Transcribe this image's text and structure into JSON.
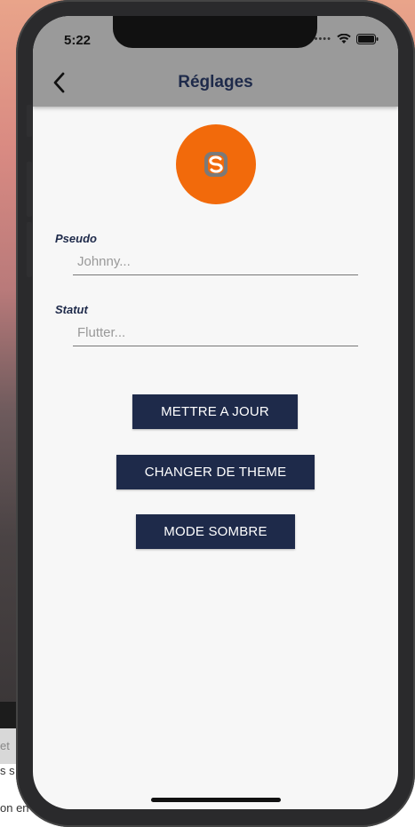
{
  "status_bar": {
    "time": "5:22",
    "dots": "••••"
  },
  "app_bar": {
    "title": "Réglages"
  },
  "form": {
    "pseudo_label": "Pseudo",
    "pseudo_placeholder": "Johnny...",
    "statut_label": "Statut",
    "statut_placeholder": "Flutter..."
  },
  "buttons": {
    "update": "METTRE A JOUR",
    "theme": "CHANGER DE THEME",
    "dark": "MODE SOMBRE"
  },
  "background_text": {
    "t1": "et",
    "t2": "s s",
    "t3": "on en"
  },
  "colors": {
    "accent": "#1e2a4a",
    "avatar": "#f26a0b",
    "app_bar": "#9a9a9a"
  },
  "icons": {
    "back": "chevron-left-icon",
    "wifi": "wifi-icon",
    "battery": "battery-icon",
    "avatar": "app-logo-icon"
  }
}
